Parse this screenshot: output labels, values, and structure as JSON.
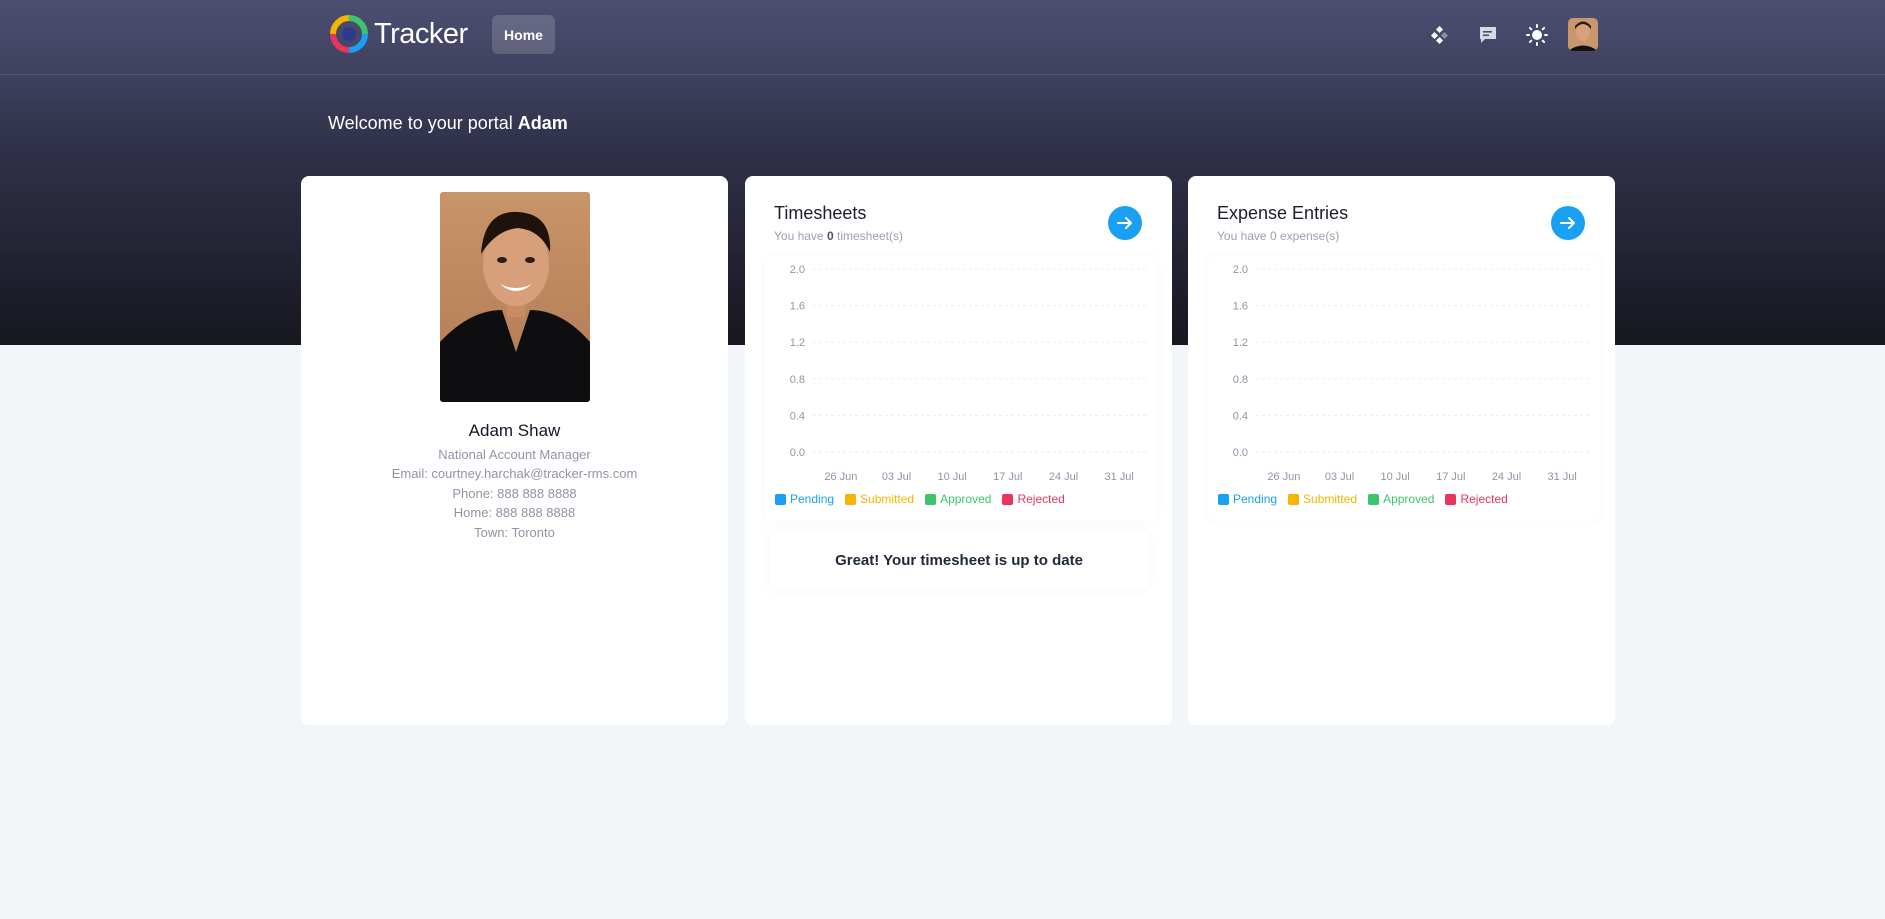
{
  "header": {
    "logo_text": "Tracker",
    "nav": {
      "home_label": "Home"
    },
    "icons": [
      "apps-icon",
      "chat-icon",
      "sun-icon"
    ]
  },
  "welcome": {
    "prefix": "Welcome to your portal",
    "name": "Adam"
  },
  "profile": {
    "name": "Adam Shaw",
    "title": "National Account Manager",
    "email": "Email: courtney.harchak@tracker-rms.com",
    "phone": "Phone: 888 888 8888",
    "home": "Home: 888 888 8888",
    "town": "Town: Toronto"
  },
  "timesheets": {
    "title": "Timesheets",
    "sub_prefix": "You have",
    "count": "0",
    "sub_suffix": "timesheet(s)",
    "status_message": "Great! Your timesheet is up to date"
  },
  "expenses": {
    "title": "Expense Entries",
    "sub": "You have 0 expense(s)"
  },
  "legend": [
    {
      "label": "Pending",
      "color": "#1aa0f3"
    },
    {
      "label": "Submitted",
      "color": "#f7b500"
    },
    {
      "label": "Approved",
      "color": "#3ec46d"
    },
    {
      "label": "Rejected",
      "color": "#e8355e"
    }
  ],
  "chart_data": [
    {
      "type": "bar",
      "categories": [
        "26 Jun",
        "03 Jul",
        "10 Jul",
        "17 Jul",
        "24 Jul",
        "31 Jul"
      ],
      "yticks": [
        "2.0",
        "1.6",
        "1.2",
        "0.8",
        "0.4",
        "0.0"
      ],
      "ylim": [
        0,
        2
      ],
      "series": [
        {
          "name": "Pending",
          "values": [
            0,
            0,
            0,
            0,
            0,
            0
          ]
        },
        {
          "name": "Submitted",
          "values": [
            0,
            0,
            0,
            0,
            0,
            0
          ]
        },
        {
          "name": "Approved",
          "values": [
            0,
            0,
            0,
            0,
            0,
            0
          ]
        },
        {
          "name": "Rejected",
          "values": [
            0,
            0,
            0,
            0,
            0,
            0
          ]
        }
      ],
      "legend": "bottom-left",
      "grid": true
    },
    {
      "type": "bar",
      "categories": [
        "26 Jun",
        "03 Jul",
        "10 Jul",
        "17 Jul",
        "24 Jul",
        "31 Jul"
      ],
      "yticks": [
        "2.0",
        "1.6",
        "1.2",
        "0.8",
        "0.4",
        "0.0"
      ],
      "ylim": [
        0,
        2
      ],
      "series": [
        {
          "name": "Pending",
          "values": [
            0,
            0,
            0,
            0,
            0,
            0
          ]
        },
        {
          "name": "Submitted",
          "values": [
            0,
            0,
            0,
            0,
            0,
            0
          ]
        },
        {
          "name": "Approved",
          "values": [
            0,
            0,
            0,
            0,
            0,
            0
          ]
        },
        {
          "name": "Rejected",
          "values": [
            0,
            0,
            0,
            0,
            0,
            0
          ]
        }
      ],
      "legend": "bottom-left",
      "grid": true
    }
  ]
}
